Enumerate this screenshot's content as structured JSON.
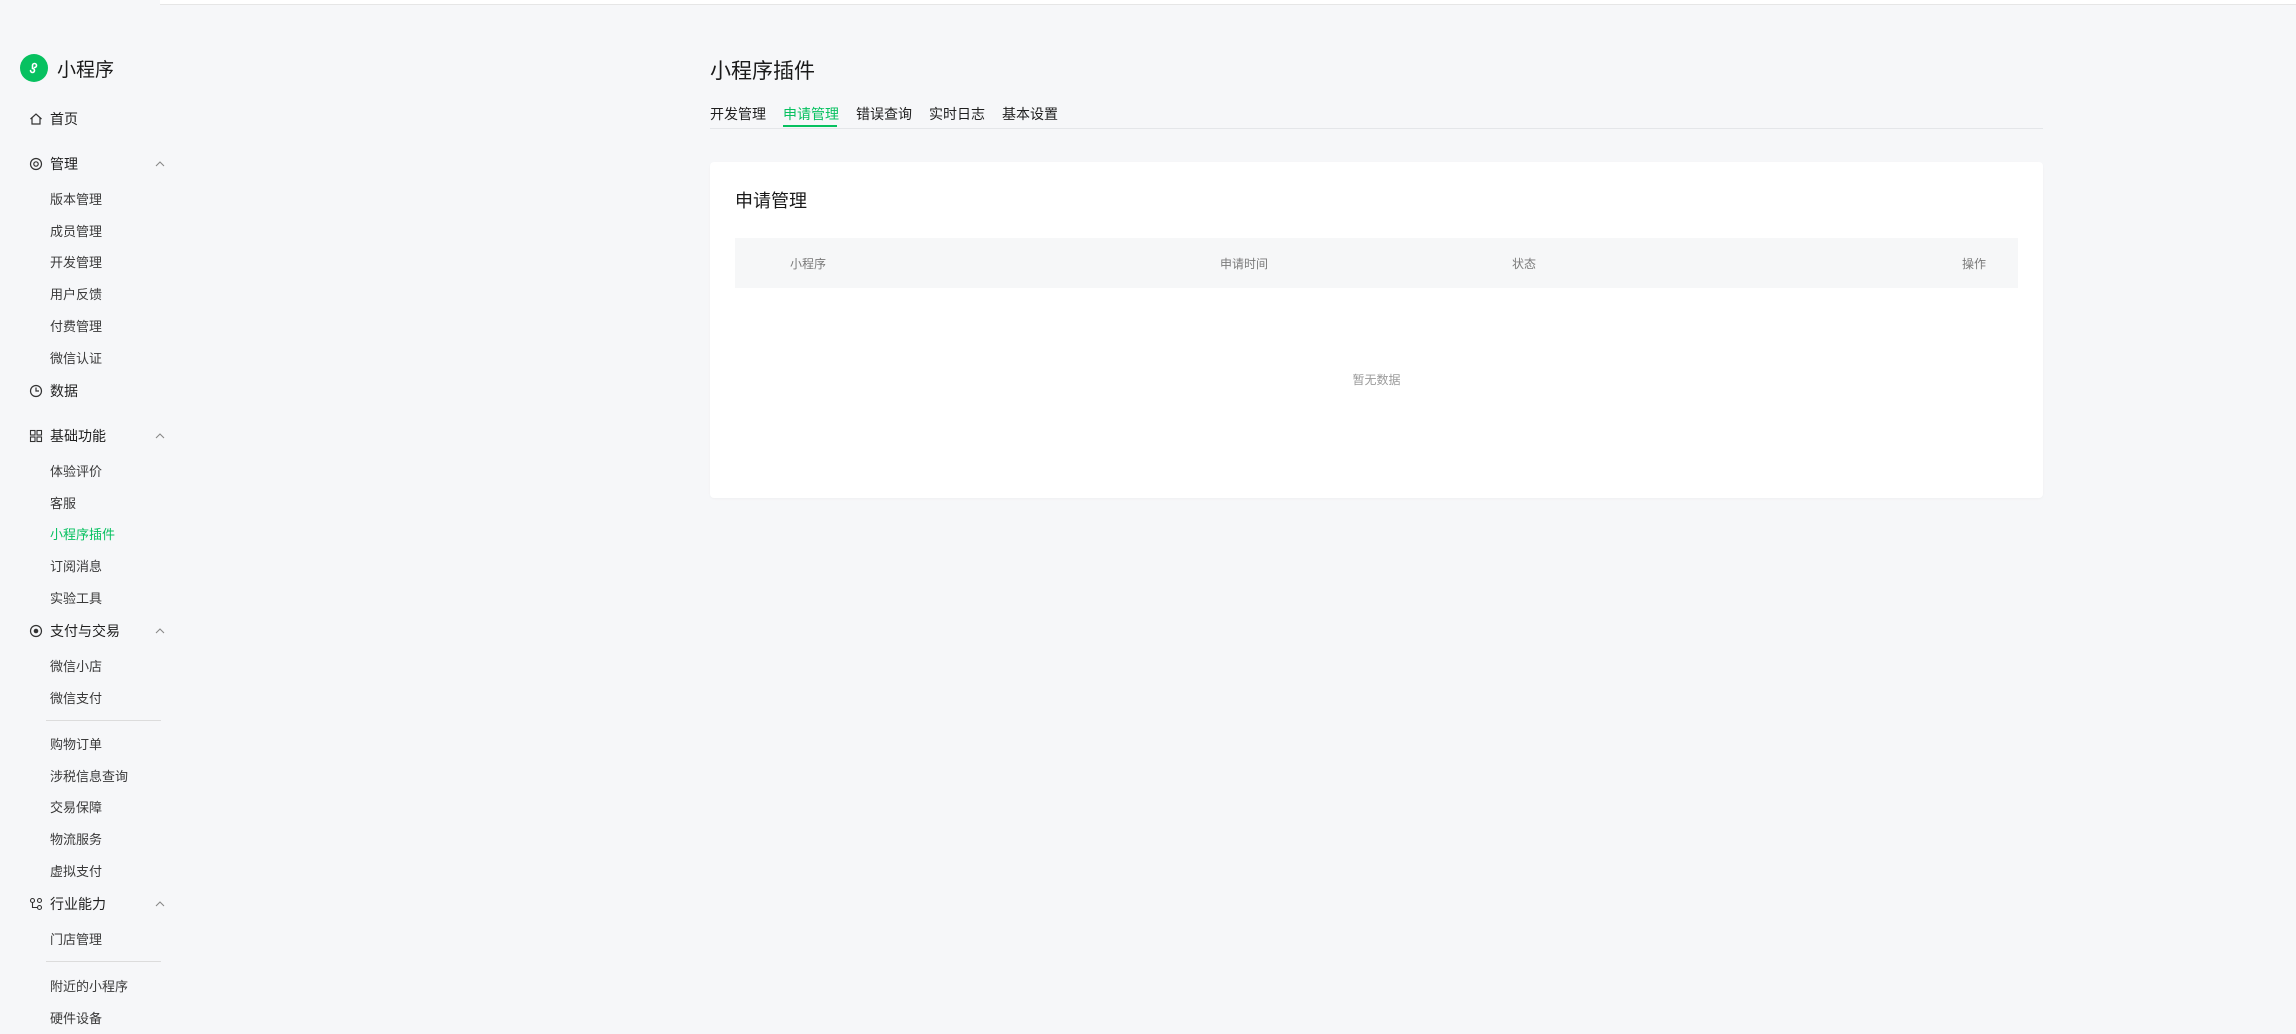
{
  "app": {
    "brand": "小程序"
  },
  "sidebar": {
    "home": "首页",
    "groups": [
      {
        "label": "管理",
        "items": [
          "版本管理",
          "成员管理",
          "开发管理",
          "用户反馈",
          "付费管理",
          "微信认证"
        ]
      },
      {
        "label": "数据",
        "items": []
      },
      {
        "label": "基础功能",
        "items": [
          "体验评价",
          "客服",
          "小程序插件",
          "订阅消息",
          "实验工具"
        ]
      },
      {
        "label": "支付与交易",
        "items": [
          "微信小店",
          "微信支付",
          "购物订单",
          "涉税信息查询",
          "交易保障",
          "物流服务",
          "虚拟支付"
        ]
      },
      {
        "label": "行业能力",
        "items": [
          "门店管理",
          "附近的小程序",
          "硬件设备"
        ]
      }
    ],
    "active_item": "小程序插件"
  },
  "main": {
    "title": "小程序插件",
    "tabs": [
      "开发管理",
      "申请管理",
      "错误查询",
      "实时日志",
      "基本设置"
    ],
    "active_tab": "申请管理",
    "card": {
      "title": "申请管理",
      "columns": [
        "小程序",
        "申请时间",
        "状态",
        "操作"
      ],
      "empty_text": "暂无数据"
    }
  },
  "colors": {
    "accent": "#07c160",
    "background": "#f6f7f9",
    "card": "#ffffff"
  }
}
